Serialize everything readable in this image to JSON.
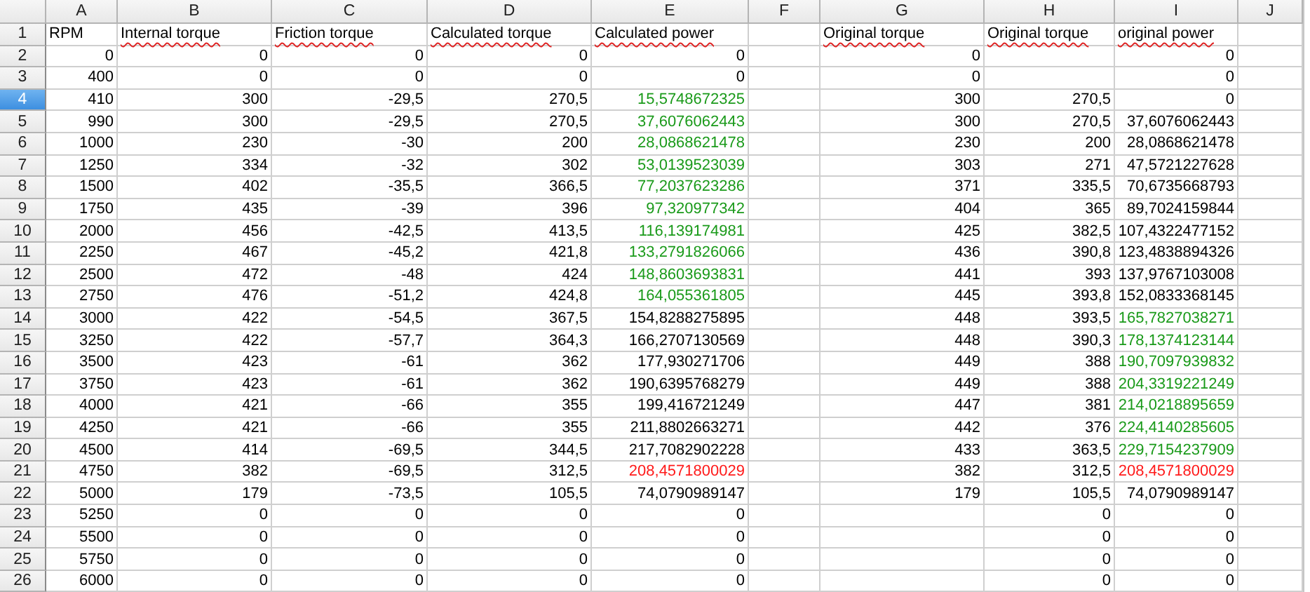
{
  "columns": [
    {
      "label": "A",
      "selected": false
    },
    {
      "label": "B",
      "selected": false
    },
    {
      "label": "C",
      "selected": false
    },
    {
      "label": "D",
      "selected": false
    },
    {
      "label": "E",
      "selected": false
    },
    {
      "label": "F",
      "selected": false
    },
    {
      "label": "G",
      "selected": false
    },
    {
      "label": "H",
      "selected": false
    },
    {
      "label": "I",
      "selected": false
    },
    {
      "label": "J",
      "selected": false
    }
  ],
  "rows": [
    {
      "number": "1",
      "selected": false,
      "kind": "labels",
      "cells": [
        {
          "text": "RPM",
          "spell_error": false
        },
        {
          "text": "Internal torque",
          "spell_error": true
        },
        {
          "text": "Friction torque",
          "spell_error": true
        },
        {
          "text": "Calculated torque",
          "spell_error": true
        },
        {
          "text": "Calculated power",
          "spell_error": true
        },
        null,
        {
          "text": "Original torque",
          "spell_error": true
        },
        {
          "text": "Original torque",
          "spell_error": true
        },
        {
          "text": "original power",
          "spell_error": true
        },
        null
      ]
    },
    {
      "number": "2",
      "selected": false,
      "kind": "values",
      "cells": [
        "0",
        "0",
        "0",
        "0",
        "0",
        null,
        "0",
        null,
        "0",
        null
      ]
    },
    {
      "number": "3",
      "selected": false,
      "kind": "values",
      "cells": [
        "400",
        "0",
        "0",
        "0",
        "0",
        null,
        "0",
        null,
        "0",
        null
      ]
    },
    {
      "number": "4",
      "selected": true,
      "kind": "values",
      "cells": [
        "410",
        "300",
        "-29,5",
        "270,5",
        {
          "text": "15,5748672325",
          "color": "#1a9a1a"
        },
        null,
        "300",
        "270,5",
        "0",
        null
      ]
    },
    {
      "number": "5",
      "selected": false,
      "kind": "values",
      "cells": [
        "990",
        "300",
        "-29,5",
        "270,5",
        {
          "text": "37,6076062443",
          "color": "#1a9a1a"
        },
        null,
        "300",
        "270,5",
        "37,6076062443",
        null
      ]
    },
    {
      "number": "6",
      "selected": false,
      "kind": "values",
      "cells": [
        "1000",
        "230",
        "-30",
        "200",
        {
          "text": "28,0868621478",
          "color": "#1a9a1a"
        },
        null,
        "230",
        "200",
        "28,0868621478",
        null
      ]
    },
    {
      "number": "7",
      "selected": false,
      "kind": "values",
      "cells": [
        "1250",
        "334",
        "-32",
        "302",
        {
          "text": "53,0139523039",
          "color": "#1a9a1a"
        },
        null,
        "303",
        "271",
        "47,5721227628",
        null
      ]
    },
    {
      "number": "8",
      "selected": false,
      "kind": "values",
      "cells": [
        "1500",
        "402",
        "-35,5",
        "366,5",
        {
          "text": "77,2037623286",
          "color": "#1a9a1a"
        },
        null,
        "371",
        "335,5",
        "70,6735668793",
        null
      ]
    },
    {
      "number": "9",
      "selected": false,
      "kind": "values",
      "cells": [
        "1750",
        "435",
        "-39",
        "396",
        {
          "text": "97,320977342",
          "color": "#1a9a1a"
        },
        null,
        "404",
        "365",
        "89,7024159844",
        null
      ]
    },
    {
      "number": "10",
      "selected": false,
      "kind": "values",
      "cells": [
        "2000",
        "456",
        "-42,5",
        "413,5",
        {
          "text": "116,139174981",
          "color": "#1a9a1a"
        },
        null,
        "425",
        "382,5",
        "107,4322477152",
        null
      ]
    },
    {
      "number": "11",
      "selected": false,
      "kind": "values",
      "cells": [
        "2250",
        "467",
        "-45,2",
        "421,8",
        {
          "text": "133,2791826066",
          "color": "#1a9a1a"
        },
        null,
        "436",
        "390,8",
        "123,4838894326",
        null
      ]
    },
    {
      "number": "12",
      "selected": false,
      "kind": "values",
      "cells": [
        "2500",
        "472",
        "-48",
        "424",
        {
          "text": "148,8603693831",
          "color": "#1a9a1a"
        },
        null,
        "441",
        "393",
        "137,9767103008",
        null
      ]
    },
    {
      "number": "13",
      "selected": false,
      "kind": "values",
      "cells": [
        "2750",
        "476",
        "-51,2",
        "424,8",
        {
          "text": "164,055361805",
          "color": "#1a9a1a"
        },
        null,
        "445",
        "393,8",
        "152,0833368145",
        null
      ]
    },
    {
      "number": "14",
      "selected": false,
      "kind": "values",
      "cells": [
        "3000",
        "422",
        "-54,5",
        "367,5",
        "154,8288275895",
        null,
        "448",
        "393,5",
        {
          "text": "165,7827038271",
          "color": "#1a9a1a"
        },
        null
      ]
    },
    {
      "number": "15",
      "selected": false,
      "kind": "values",
      "cells": [
        "3250",
        "422",
        "-57,7",
        "364,3",
        "166,2707130569",
        null,
        "448",
        "390,3",
        {
          "text": "178,1374123144",
          "color": "#1a9a1a"
        },
        null
      ]
    },
    {
      "number": "16",
      "selected": false,
      "kind": "values",
      "cells": [
        "3500",
        "423",
        "-61",
        "362",
        "177,930271706",
        null,
        "449",
        "388",
        {
          "text": "190,7097939832",
          "color": "#1a9a1a"
        },
        null
      ]
    },
    {
      "number": "17",
      "selected": false,
      "kind": "values",
      "cells": [
        "3750",
        "423",
        "-61",
        "362",
        "190,6395768279",
        null,
        "449",
        "388",
        {
          "text": "204,3319221249",
          "color": "#1a9a1a"
        },
        null
      ]
    },
    {
      "number": "18",
      "selected": false,
      "kind": "values",
      "cells": [
        "4000",
        "421",
        "-66",
        "355",
        "199,416721249",
        null,
        "447",
        "381",
        {
          "text": "214,0218895659",
          "color": "#1a9a1a"
        },
        null
      ]
    },
    {
      "number": "19",
      "selected": false,
      "kind": "values",
      "cells": [
        "4250",
        "421",
        "-66",
        "355",
        "211,8802663271",
        null,
        "442",
        "376",
        {
          "text": "224,4140285605",
          "color": "#1a9a1a"
        },
        null
      ]
    },
    {
      "number": "20",
      "selected": false,
      "kind": "values",
      "cells": [
        "4500",
        "414",
        "-69,5",
        "344,5",
        "217,7082902228",
        null,
        "433",
        "363,5",
        {
          "text": "229,7154237909",
          "color": "#1a9a1a"
        },
        null
      ]
    },
    {
      "number": "21",
      "selected": false,
      "kind": "values",
      "cells": [
        "4750",
        "382",
        "-69,5",
        "312,5",
        {
          "text": "208,4571800029",
          "color": "#ff1a1a"
        },
        null,
        "382",
        "312,5",
        {
          "text": "208,4571800029",
          "color": "#ff1a1a"
        },
        null
      ]
    },
    {
      "number": "22",
      "selected": false,
      "kind": "values",
      "cells": [
        "5000",
        "179",
        "-73,5",
        "105,5",
        "74,0790989147",
        null,
        "179",
        "105,5",
        "74,0790989147",
        null
      ]
    },
    {
      "number": "23",
      "selected": false,
      "kind": "values",
      "cells": [
        "5250",
        "0",
        "0",
        "0",
        "0",
        null,
        null,
        "0",
        "0",
        null
      ]
    },
    {
      "number": "24",
      "selected": false,
      "kind": "values",
      "cells": [
        "5500",
        "0",
        "0",
        "0",
        "0",
        null,
        null,
        "0",
        "0",
        null
      ]
    },
    {
      "number": "25",
      "selected": false,
      "kind": "values",
      "cells": [
        "5750",
        "0",
        "0",
        "0",
        "0",
        null,
        null,
        "0",
        "0",
        null
      ]
    },
    {
      "number": "26",
      "selected": false,
      "kind": "values",
      "cells": [
        "6000",
        "0",
        "0",
        "0",
        "0",
        null,
        null,
        "0",
        "0",
        null
      ]
    }
  ]
}
